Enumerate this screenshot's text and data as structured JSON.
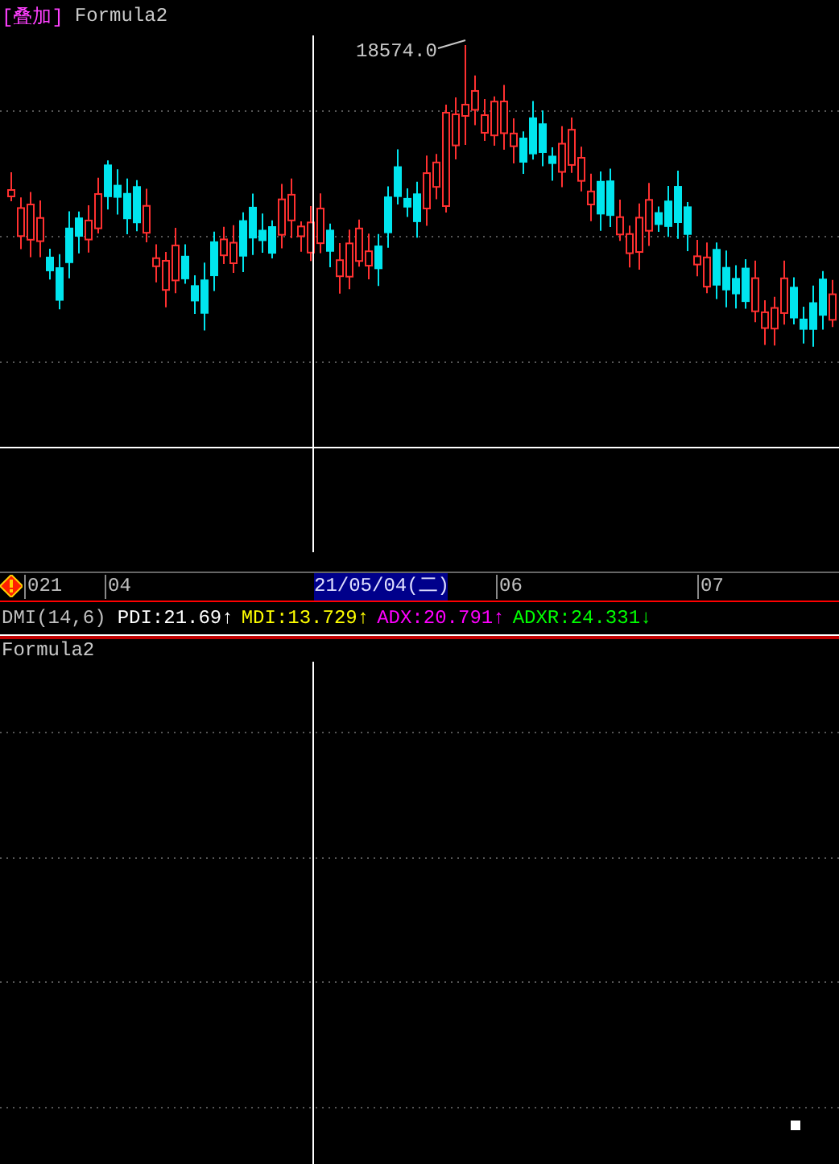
{
  "main_panel": {
    "overlay_tag": "[叠加]",
    "title": "Formula2",
    "peak_label": "18574.0"
  },
  "time_axis": {
    "labels": [
      {
        "text": "021",
        "kind": "year"
      },
      {
        "text": "04",
        "kind": "month"
      },
      {
        "text": "06",
        "kind": "month"
      },
      {
        "text": "07",
        "kind": "month"
      }
    ],
    "cursor_date": "21/05/04(二)"
  },
  "indicator": {
    "name": "DMI(14,6)",
    "values": [
      {
        "label": "PDI:",
        "value": "21.69",
        "arrow": "↑",
        "color": "#ffffff"
      },
      {
        "label": "MDI:",
        "value": "13.729",
        "arrow": "↑",
        "color": "#ffff00"
      },
      {
        "label": "ADX:",
        "value": "20.791",
        "arrow": "↑",
        "color": "#ff00ff"
      },
      {
        "label": "ADXR:",
        "value": "24.331",
        "arrow": "↓",
        "color": "#00ff00"
      }
    ]
  },
  "lower_panel": {
    "title": "Formula2"
  }
}
